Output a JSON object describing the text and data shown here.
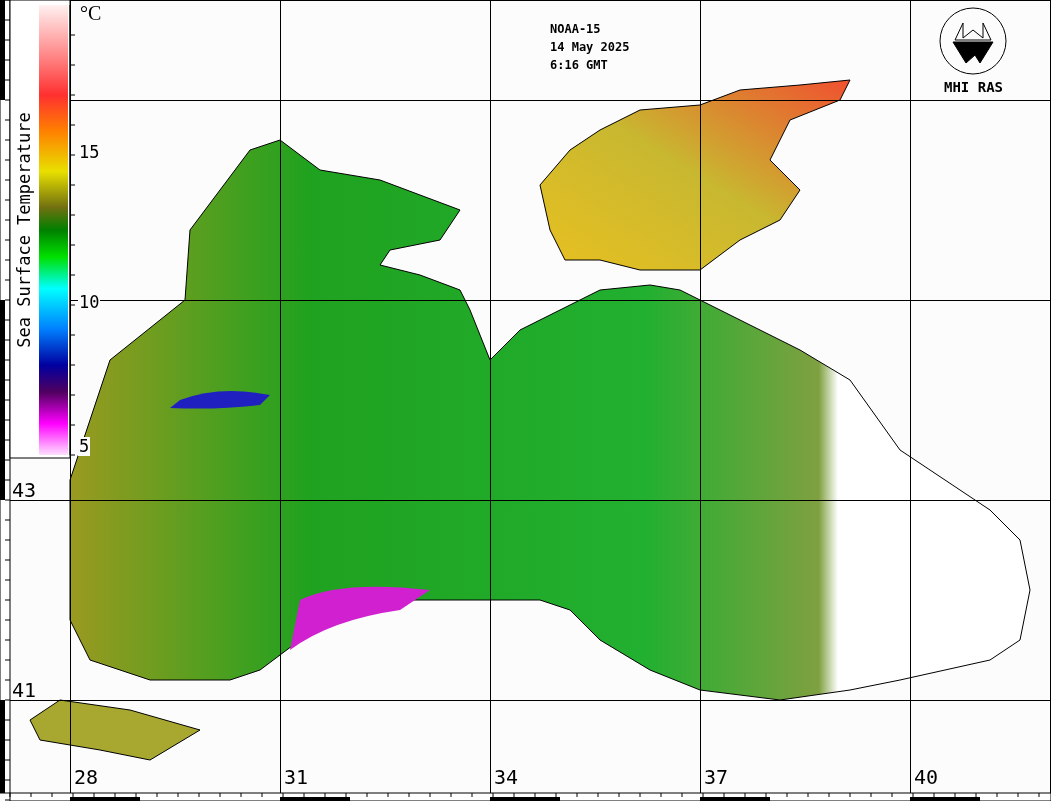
{
  "header": {
    "lines": [
      "NOAA-15",
      "14 May 2025",
      "6:16 GMT"
    ]
  },
  "logo": {
    "text": "MHI RAS"
  },
  "colorbar": {
    "title": "Sea Surface Temperature",
    "unit": "°C",
    "ticks": [
      "15",
      "10",
      "5"
    ]
  },
  "latitudes": [
    "43",
    "41"
  ],
  "longitudes": [
    "28",
    "31",
    "34",
    "37",
    "40"
  ]
}
